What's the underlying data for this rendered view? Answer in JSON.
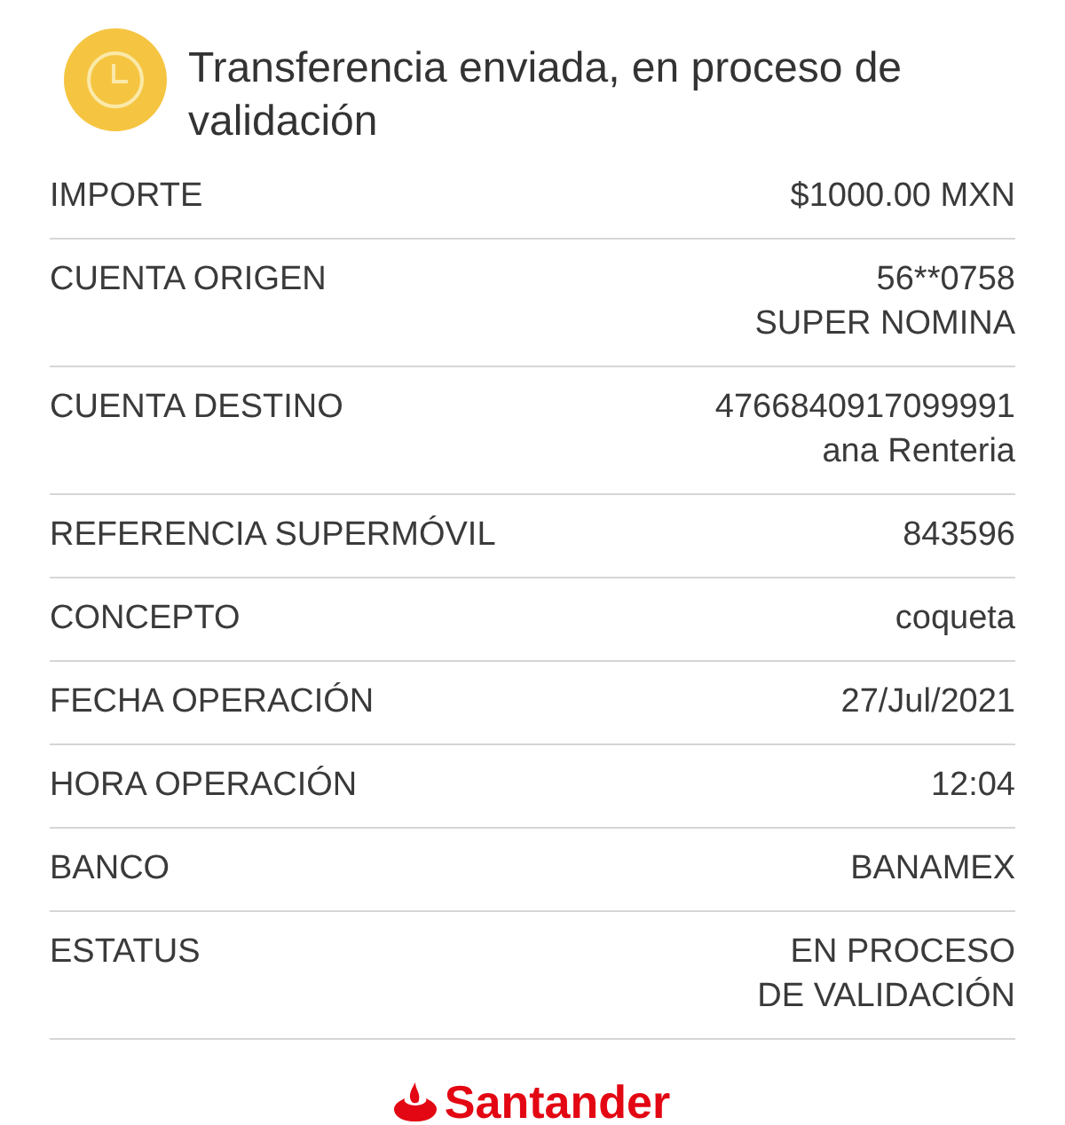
{
  "header": {
    "title": "Transferencia enviada, en proceso de validación"
  },
  "rows": [
    {
      "label": "IMPORTE",
      "values": [
        "$1000.00 MXN"
      ]
    },
    {
      "label": "CUENTA ORIGEN",
      "values": [
        "56**0758",
        "SUPER NOMINA"
      ]
    },
    {
      "label": "CUENTA DESTINO",
      "values": [
        "4766840917099991",
        "ana Renteria"
      ]
    },
    {
      "label": "REFERENCIA SUPERMÓVIL",
      "values": [
        "843596"
      ]
    },
    {
      "label": "CONCEPTO",
      "values": [
        "coqueta"
      ]
    },
    {
      "label": "FECHA OPERACIÓN",
      "values": [
        "27/Jul/2021"
      ]
    },
    {
      "label": "HORA OPERACIÓN",
      "values": [
        "12:04"
      ]
    },
    {
      "label": "BANCO",
      "values": [
        "BANAMEX"
      ]
    },
    {
      "label": "ESTATUS",
      "values": [
        "EN PROCESO",
        "DE VALIDACIÓN"
      ]
    }
  ],
  "footer": {
    "logo_text": "Santander"
  }
}
